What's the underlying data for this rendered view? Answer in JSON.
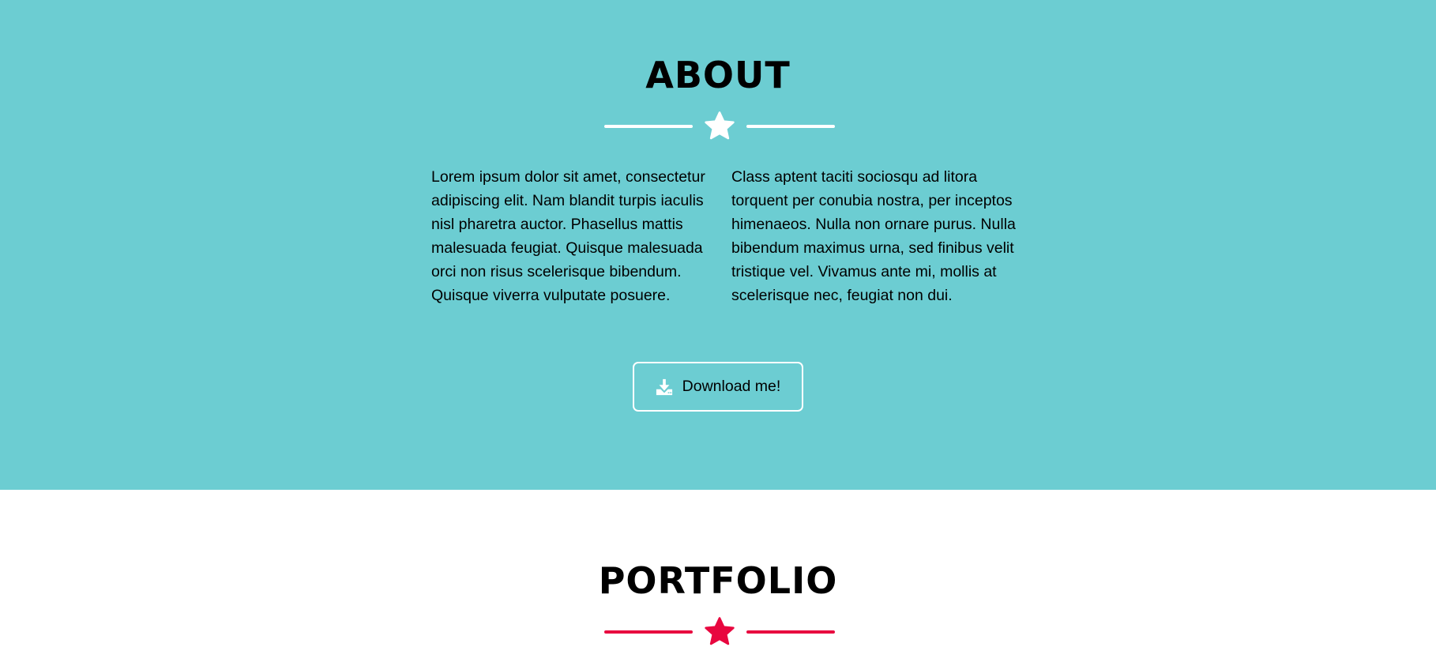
{
  "colors": {
    "about_background": "#6ccdd2",
    "about_text": "#ffffff",
    "portfolio_background": "#ffffff",
    "portfolio_accent": "#e8073f"
  },
  "about": {
    "title": "ABOUT",
    "divider_icon": "star-icon",
    "column_left": "Lorem ipsum dolor sit amet, consectetur adipiscing elit. Nam blandit turpis iaculis nisl pharetra auctor. Phasellus mattis malesuada feugiat. Quisque malesuada orci non risus scelerisque bibendum. Quisque viverra vulputate posuere.",
    "column_right": "Class aptent taciti sociosqu ad litora torquent per conubia nostra, per inceptos himenaeos. Nulla non ornare purus. Nulla bibendum maximus urna, sed finibus velit tristique vel. Vivamus ante mi, mollis at scelerisque nec, feugiat non dui.",
    "download_button": {
      "label": "Download me!",
      "icon": "download-icon"
    }
  },
  "portfolio": {
    "title": "PORTFOLIO",
    "divider_icon": "star-icon"
  }
}
